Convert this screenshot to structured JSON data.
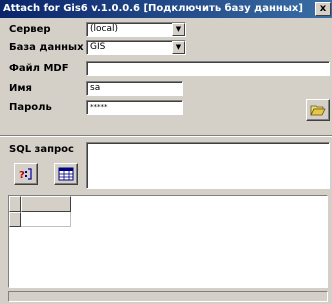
{
  "window": {
    "title": "Attach for Gis6 v.1.0.0.6 [Подключить базу данных]",
    "close_label": "x"
  },
  "form": {
    "server_label": "Сервер",
    "server_value": "(local)",
    "database_label": "База данных",
    "database_value": "GIS",
    "mdf_label": "Файл MDF",
    "mdf_value": "",
    "name_label": "Имя",
    "name_value": "sa",
    "password_label": "Пароль",
    "password_value": "*****"
  },
  "sql": {
    "label": "SQL запрос",
    "query": ""
  },
  "icons": {
    "dropdown": "dropdown-arrow-icon",
    "browse": "folder-open-icon",
    "query": "query-icon",
    "table": "table-grid-icon"
  },
  "colors": {
    "title_start": "#0a246a",
    "title_end": "#3a6ea5",
    "face": "#d4d0c8"
  }
}
